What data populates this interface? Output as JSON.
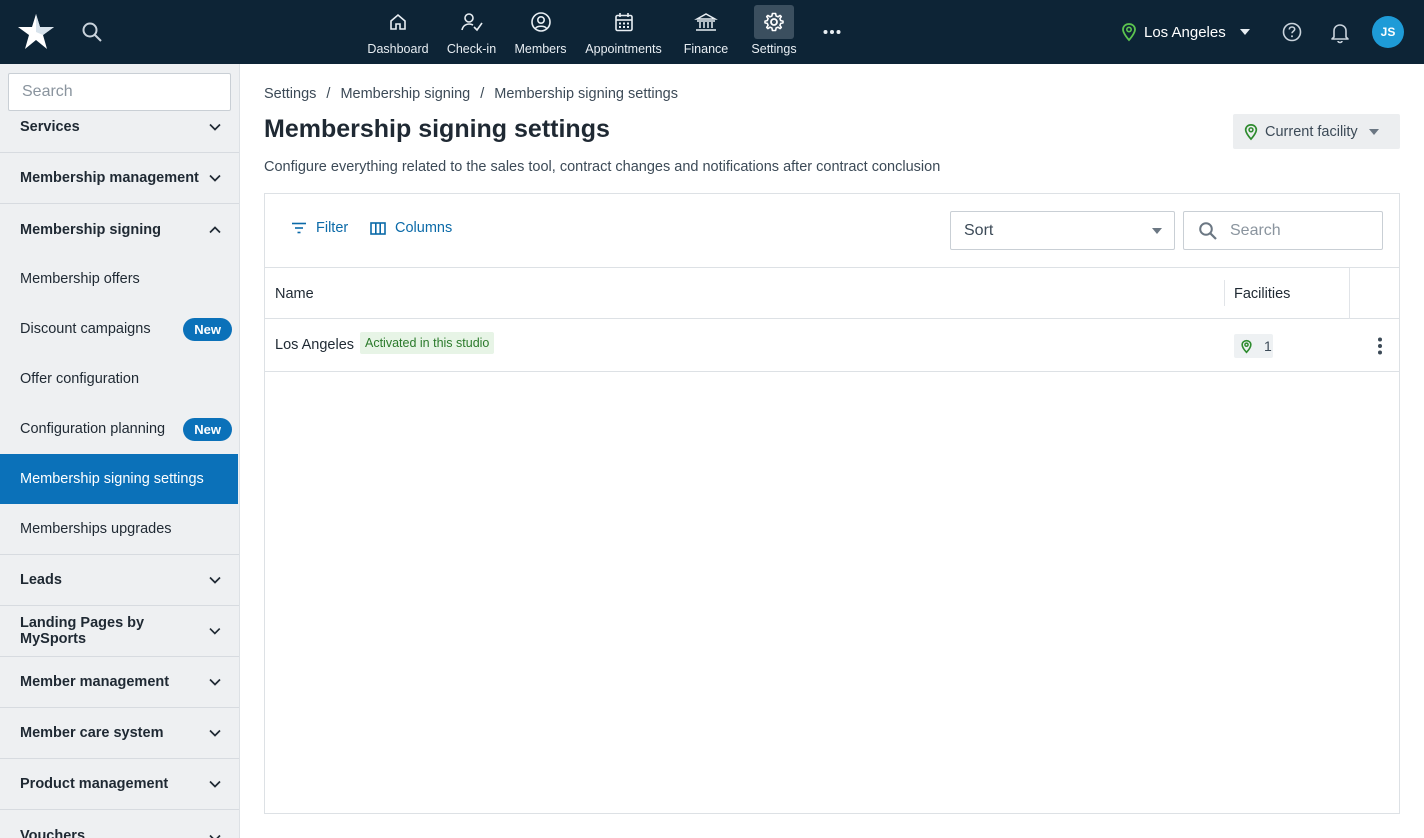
{
  "topnav": {
    "items": [
      {
        "label": "Dashboard",
        "icon": "home-icon"
      },
      {
        "label": "Check-in",
        "icon": "check-in-icon"
      },
      {
        "label": "Members",
        "icon": "user-circle-icon"
      },
      {
        "label": "Appointments",
        "icon": "calendar-icon"
      },
      {
        "label": "Finance",
        "icon": "bank-icon"
      },
      {
        "label": "Settings",
        "icon": "gear-icon",
        "active": true
      }
    ],
    "location": "Los Angeles",
    "avatar_initials": "JS",
    "colors": {
      "bar": "#0d2436",
      "accent": "#1e9bd7"
    }
  },
  "sidebar": {
    "search_placeholder": "Search",
    "sections_top": [
      {
        "label": "Services"
      },
      {
        "label": "Membership management"
      },
      {
        "label": "Membership signing",
        "expanded": true
      }
    ],
    "subitems": [
      {
        "label": "Membership offers"
      },
      {
        "label": "Discount campaigns",
        "badge": "New"
      },
      {
        "label": "Offer configuration"
      },
      {
        "label": "Configuration planning",
        "badge": "New"
      },
      {
        "label": "Membership signing settings",
        "active": true
      },
      {
        "label": "Memberships upgrades"
      }
    ],
    "sections_bottom": [
      {
        "label": "Leads"
      },
      {
        "label": "Landing Pages by MySports"
      },
      {
        "label": "Member management"
      },
      {
        "label": "Member care system"
      },
      {
        "label": "Product management"
      },
      {
        "label": "Vouchers"
      }
    ],
    "active_color": "#0b71b9"
  },
  "breadcrumb": [
    "Settings",
    "Membership signing",
    "Membership signing settings"
  ],
  "page": {
    "title": "Membership signing settings",
    "description": "Configure everything related to the sales tool, contract changes and notifications after contract conclusion",
    "facility_filter": "Current facility"
  },
  "toolbar": {
    "filter_label": "Filter",
    "columns_label": "Columns",
    "sort_label": "Sort",
    "search_placeholder": "Search"
  },
  "table": {
    "columns": [
      "Name",
      "Facilities"
    ],
    "rows": [
      {
        "name": "Los Angeles",
        "status": "Activated in this studio",
        "facilities": "1"
      }
    ]
  }
}
